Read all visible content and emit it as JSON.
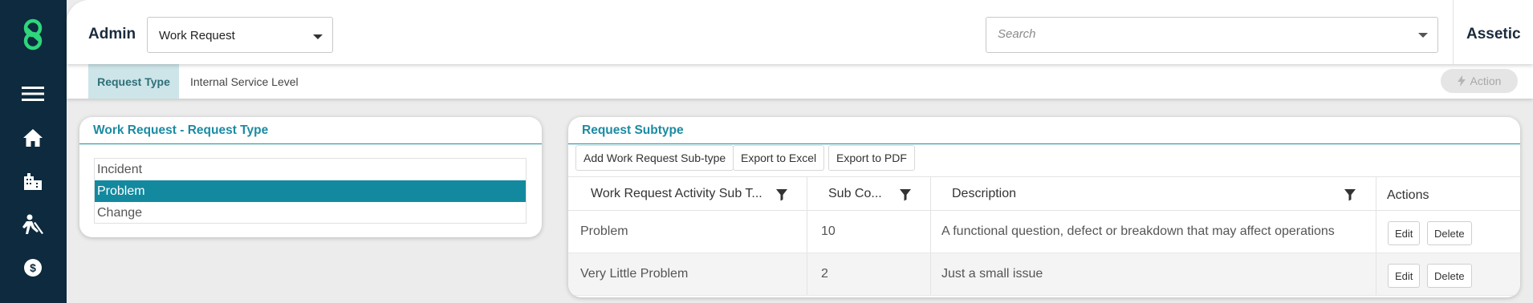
{
  "header": {
    "title": "Admin",
    "module_select_value": "Work Request",
    "search_placeholder": "Search",
    "brand": "Assetic"
  },
  "nav": {
    "icons": [
      "assetic-logo-icon",
      "hamburger-menu-icon",
      "home-icon",
      "buildings-icon",
      "worker-icon",
      "finance-icon"
    ]
  },
  "tabs": {
    "active": "Request Type",
    "second": "Internal Service Level",
    "action_label": "Action"
  },
  "left_panel": {
    "title": "Work Request - Request Type",
    "items": [
      "Incident",
      "Problem",
      "Change"
    ],
    "selected_index": 1
  },
  "right_panel": {
    "title": "Request Subtype",
    "toolbar": {
      "add_label": "Add Work Request Sub-type",
      "excel_label": "Export to Excel",
      "pdf_label": "Export to PDF"
    },
    "columns": [
      "Work Request Activity Sub T...",
      "Sub Co...",
      "Description",
      "Actions"
    ],
    "rows": [
      {
        "name": "Problem",
        "code": "10",
        "description": "A functional question, defect or breakdown that may affect operations"
      },
      {
        "name": "Very Little Problem",
        "code": "2",
        "description": "Just a small issue"
      }
    ],
    "edit_label": "Edit",
    "delete_label": "Delete"
  },
  "colors": {
    "nav_bg": "#0d2a3e",
    "accent": "#1b8ba3",
    "selected_row": "#12899f",
    "active_tab_bg": "#cde5e9"
  }
}
